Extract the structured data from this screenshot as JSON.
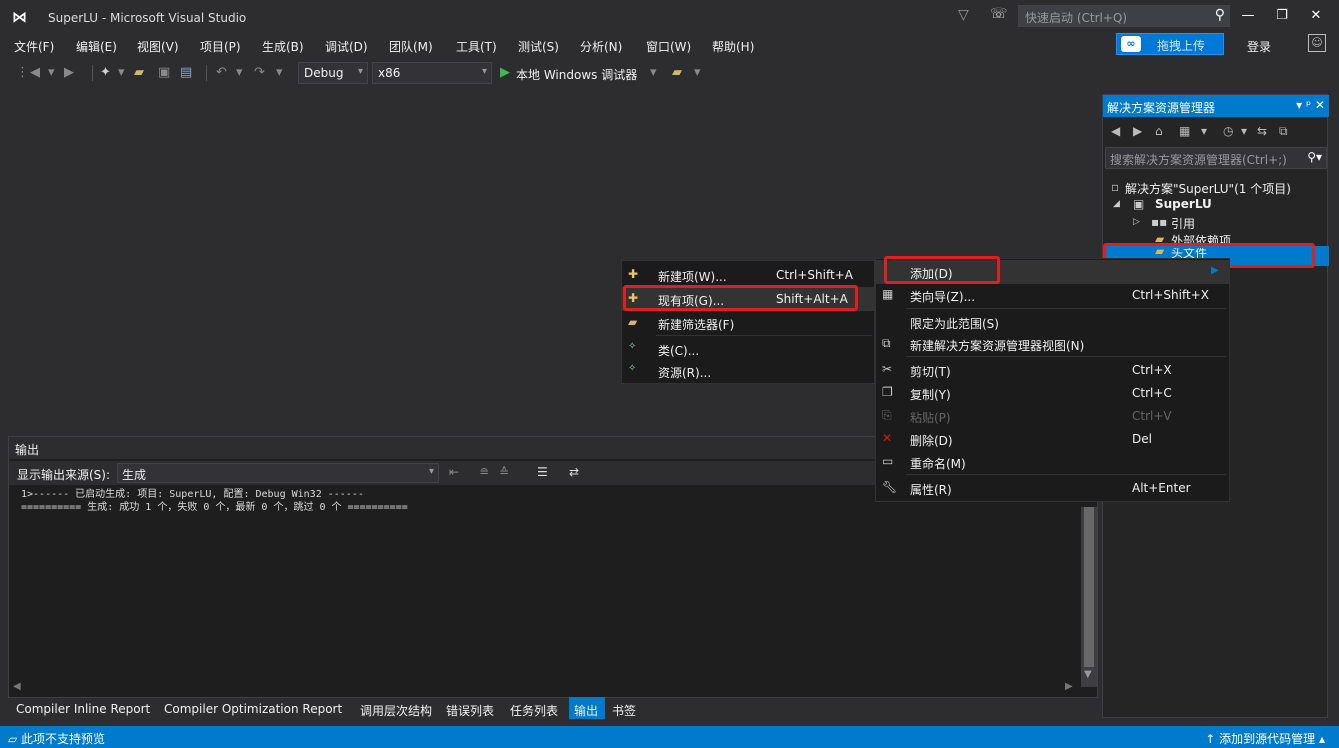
{
  "window": {
    "title": "SuperLU - Microsoft Visual Studio",
    "logo": "⋈",
    "quick_launch_placeholder": "快速启动 (Ctrl+Q)",
    "minimize": "—",
    "restore": "❐",
    "close": "✕"
  },
  "menubar": {
    "items": [
      "文件(F)",
      "编辑(E)",
      "视图(V)",
      "项目(P)",
      "生成(B)",
      "调试(D)",
      "团队(M)",
      "工具(T)",
      "测试(S)",
      "分析(N)",
      "窗口(W)",
      "帮助(H)"
    ]
  },
  "account": {
    "upload_label": "拖拽上传",
    "login_label": "登录"
  },
  "toolbar": {
    "config_value": "Debug",
    "platform_value": "x86",
    "debugger_label": "本地 Windows 调试器"
  },
  "output": {
    "title": "输出",
    "source_label": "显示输出来源(S):",
    "source_value": "生成",
    "lines": [
      "1>------ 已启动生成: 项目: SuperLU, 配置: Debug Win32 ------",
      "========== 生成: 成功 1 个，失败 0 个，最新 0 个，跳过 0 个 =========="
    ]
  },
  "bottom_tabs": [
    "Compiler Inline Report",
    "Compiler Optimization Report",
    "调用层次结构",
    "错误列表",
    "任务列表",
    "输出",
    "书签"
  ],
  "solution_explorer": {
    "title": "解决方案资源管理器",
    "header_controls": "▾ ᵖ ✕",
    "search_placeholder": "搜索解决方案资源管理器(Ctrl+;)",
    "tree": {
      "solution": "解决方案\"SuperLU\"(1 个项目)",
      "project": "SuperLU",
      "references": "引用",
      "external_deps": "外部依赖项",
      "header_files": "头文件"
    }
  },
  "submenu": {
    "items": [
      {
        "label": "新建项(W)...",
        "shortcut": "Ctrl+Shift+A"
      },
      {
        "label": "现有项(G)...",
        "shortcut": "Shift+Alt+A"
      },
      {
        "label": "新建筛选器(F)",
        "shortcut": ""
      },
      {
        "label": "类(C)...",
        "shortcut": ""
      },
      {
        "label": "资源(R)...",
        "shortcut": ""
      }
    ]
  },
  "context_menu": {
    "items": [
      {
        "label": "添加(D)",
        "shortcut": ""
      },
      {
        "label": "类向导(Z)...",
        "shortcut": "Ctrl+Shift+X"
      },
      {
        "label": "限定为此范围(S)",
        "shortcut": ""
      },
      {
        "label": "新建解决方案资源管理器视图(N)",
        "shortcut": ""
      },
      {
        "label": "剪切(T)",
        "shortcut": "Ctrl+X"
      },
      {
        "label": "复制(Y)",
        "shortcut": "Ctrl+C"
      },
      {
        "label": "粘贴(P)",
        "shortcut": "Ctrl+V"
      },
      {
        "label": "删除(D)",
        "shortcut": "Del"
      },
      {
        "label": "重命名(M)",
        "shortcut": ""
      },
      {
        "label": "属性(R)",
        "shortcut": "Alt+Enter"
      }
    ]
  },
  "statusbar": {
    "message": "此项不支持预览",
    "source_control": "↑ 添加到源代码管理 ▴"
  },
  "colors": {
    "accent": "#007acc",
    "highlight_box": "#e02020",
    "menu_bg": "#1b1b1c"
  }
}
